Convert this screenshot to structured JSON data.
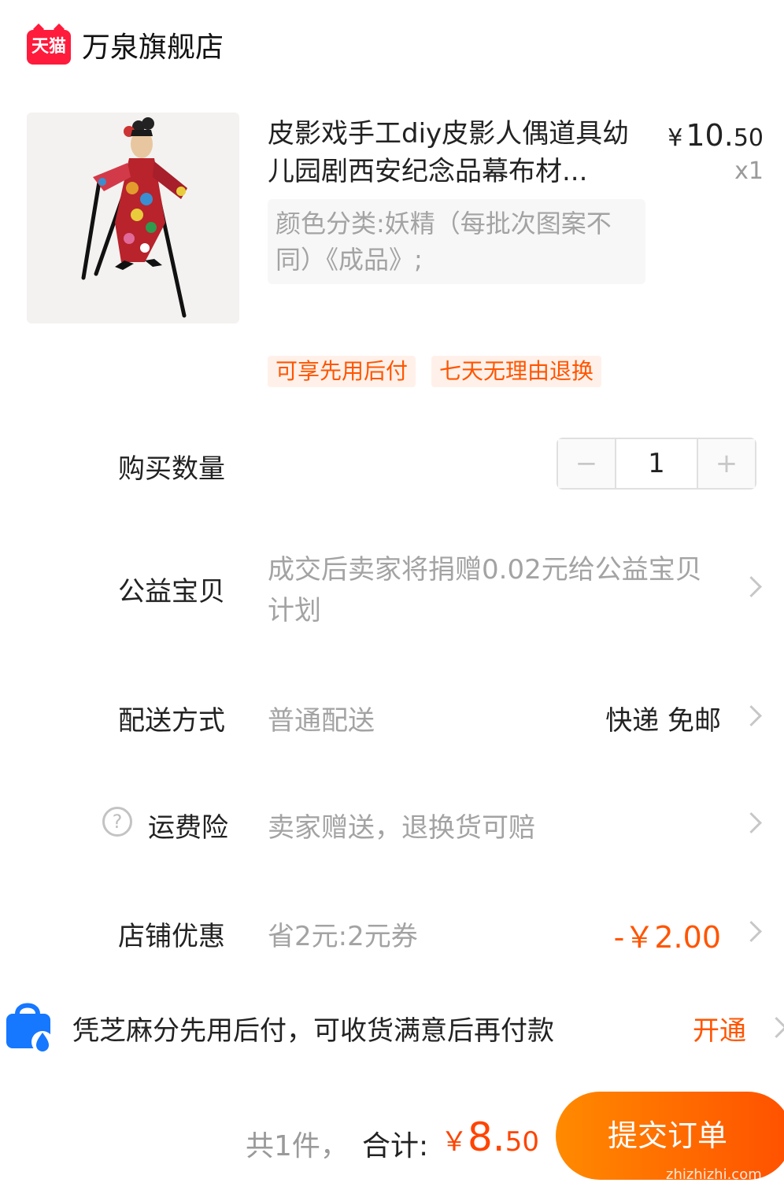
{
  "store": {
    "logo_text": "天猫",
    "name": "万泉旗舰店"
  },
  "product": {
    "title": "皮影戏手工diy皮影人偶道具幼儿园剧西安纪念品幕布材...",
    "price_yen": "¥",
    "price_int": "10.",
    "price_dec": "50",
    "quantity_badge": "x1",
    "sku": "颜色分类:妖精（每批次图案不同）《成品》;",
    "tags": [
      "可享先用后付",
      "七天无理由退换"
    ]
  },
  "quantity": {
    "label": "购买数量",
    "minus": "−",
    "value": "1",
    "plus": "+"
  },
  "charity": {
    "label": "公益宝贝",
    "value": "成交后卖家将捐赠0.02元给公益宝贝计划"
  },
  "delivery": {
    "label": "配送方式",
    "value": "普通配送",
    "right": "快递 免邮"
  },
  "insurance": {
    "help_icon": "?",
    "label": "运费险",
    "value": "卖家赠送，退换货可赔"
  },
  "store_discount": {
    "label": "店铺优惠",
    "value": "省2元:2元券",
    "amount": "-￥2.00"
  },
  "pay_later": {
    "text": "凭芝麻分先用后付，可收货满意后再付款",
    "action": "开通"
  },
  "footer": {
    "count": "共1件，",
    "total_label": "合计:",
    "total_yen": "￥",
    "total_int": "8.",
    "total_dec": "50",
    "submit": "提交订单",
    "watermark": "zhizhizhi.com"
  },
  "colors": {
    "accent": "#ff5500",
    "tmall_red": "#ff1b3c"
  }
}
